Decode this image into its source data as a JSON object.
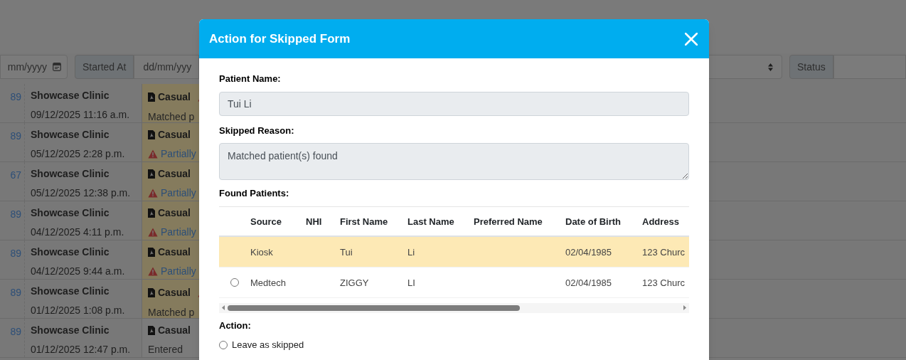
{
  "filters": {
    "first_date_placeholder": "mm/yyyy",
    "started_label": "Started At",
    "started_placeholder": "dd/mm/yyy",
    "status_label": "Status"
  },
  "rows": [
    {
      "id": "89",
      "clinic": "Showcase Clinic",
      "date": "09/12/2025 11:16 a.m.",
      "form": "Casual",
      "flagged": true,
      "status": {
        "kind": "text",
        "text": "Matched p"
      },
      "highlighted": true
    },
    {
      "id": "89",
      "clinic": "Showcase Clinic",
      "date": "05/12/2025 2:28 p.m.",
      "form": "Casual",
      "flagged": false,
      "status": {
        "kind": "warning",
        "text": "Partially"
      },
      "highlighted": true
    },
    {
      "id": "67",
      "clinic": "Showcase Clinic",
      "date": "05/12/2025 12:38 p.m.",
      "form": "Casual",
      "flagged": false,
      "status": {
        "kind": "warning",
        "text": "Partially"
      },
      "highlighted": true
    },
    {
      "id": "89",
      "clinic": "Showcase Clinic",
      "date": "04/12/2025 4:11 p.m.",
      "form": "Casual",
      "flagged": false,
      "status": {
        "kind": "warning",
        "text": "Partially"
      },
      "highlighted": true
    },
    {
      "id": "89",
      "clinic": "Showcase Clinic",
      "date": "04/12/2025 9:44 a.m.",
      "form": "Casual",
      "flagged": false,
      "status": {
        "kind": "warning",
        "text": "Partially"
      },
      "highlighted": true
    },
    {
      "id": "89",
      "clinic": "Showcase Clinic",
      "date": "01/12/2025 1:08 p.m.",
      "form": "Casual",
      "flagged": true,
      "status": {
        "kind": "text",
        "text": "Matched p"
      },
      "highlighted": true
    },
    {
      "id": "89",
      "clinic": "Showcase Clinic",
      "date": "01/12/2025 12:47 p.m.",
      "form": "Casual",
      "flagged": false,
      "status": {
        "kind": "text",
        "text": "Entered"
      },
      "highlighted": false
    }
  ],
  "modal": {
    "title": "Action for Skipped Form",
    "patient_name_label": "Patient Name:",
    "patient_name": "Tui Li",
    "skipped_reason_label": "Skipped Reason:",
    "skipped_reason": "Matched patient(s) found",
    "found_patients_label": "Found Patients:",
    "columns": [
      "Source",
      "NHI",
      "First Name",
      "Last Name",
      "Preferred Name",
      "Date of Birth",
      "Address"
    ],
    "patients": [
      {
        "cells": [
          "Kiosk",
          "",
          "Tui",
          "Li",
          "",
          "02/04/1985",
          "123 Churc"
        ],
        "selected": true
      },
      {
        "cells": [
          "Medtech",
          "",
          "ZIGGY",
          "LI",
          "",
          "02/04/1985",
          "123 Churc"
        ],
        "selected": false
      }
    ],
    "action_label": "Action:",
    "actions": [
      {
        "label": "Leave as skipped",
        "selected": false
      }
    ]
  }
}
